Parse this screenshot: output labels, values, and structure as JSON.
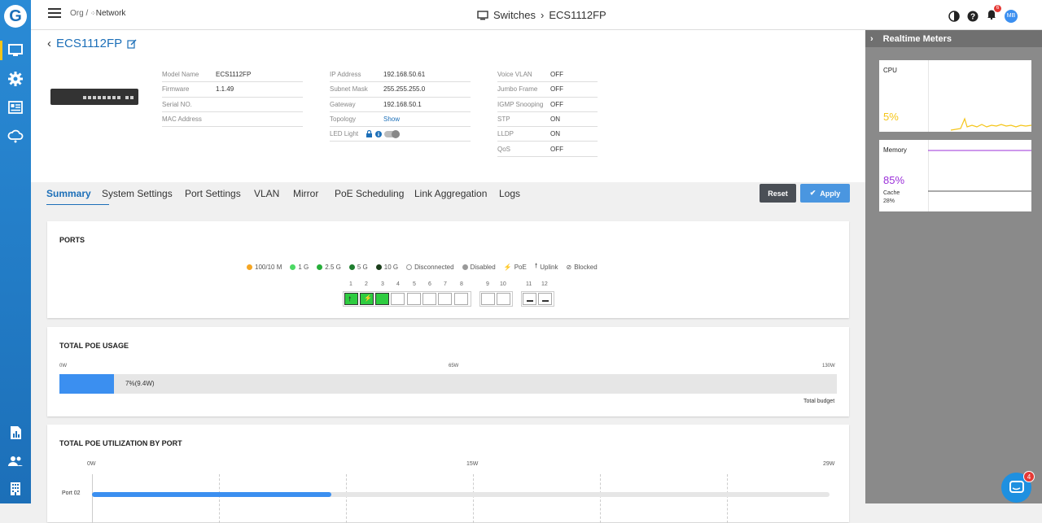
{
  "topbar": {
    "org": "Org /",
    "network": "Network",
    "title": "Switches",
    "subtitle": "ECS1112FP",
    "notif_count": "6",
    "avatar": "MB"
  },
  "device": {
    "name": "ECS1112FP",
    "col1": [
      {
        "k": "Model Name",
        "v": "ECS1112FP"
      },
      {
        "k": "Firmware",
        "v": "1.1.49"
      },
      {
        "k": "Serial NO.",
        "v": ""
      },
      {
        "k": "MAC Address",
        "v": ""
      }
    ],
    "col2": [
      {
        "k": "IP Address",
        "v": "192.168.50.61"
      },
      {
        "k": "Subnet Mask",
        "v": "255.255.255.0"
      },
      {
        "k": "Gateway",
        "v": "192.168.50.1"
      },
      {
        "k": "Topology",
        "v": "Show"
      },
      {
        "k": "LED Light",
        "v": ""
      }
    ],
    "col3": [
      {
        "k": "Voice VLAN",
        "v": "OFF"
      },
      {
        "k": "Jumbo Frame",
        "v": "OFF"
      },
      {
        "k": "IGMP Snooping",
        "v": "OFF"
      },
      {
        "k": "STP",
        "v": "ON"
      },
      {
        "k": "LLDP",
        "v": "ON"
      },
      {
        "k": "QoS",
        "v": "OFF"
      }
    ]
  },
  "tabs": [
    "Summary",
    "System Settings",
    "Port Settings",
    "VLAN",
    "Mirror",
    "PoE Scheduling",
    "Link Aggregation",
    "Logs"
  ],
  "buttons": {
    "reset": "Reset",
    "apply": "Apply"
  },
  "ports_card": {
    "title": "PORTS",
    "legend": [
      {
        "label": "100/10 M",
        "color": "#f5a623"
      },
      {
        "label": "1 G",
        "color": "#4cd964"
      },
      {
        "label": "2.5 G",
        "color": "#27ae3a"
      },
      {
        "label": "5 G",
        "color": "#1e7d2e"
      },
      {
        "label": "10 G",
        "color": "#1a3d1a"
      },
      {
        "label": "Disconnected",
        "color": "#ffffff"
      },
      {
        "label": "Disabled",
        "color": "#999999"
      },
      {
        "label": "PoE",
        "color": ""
      },
      {
        "label": "Uplink",
        "color": ""
      },
      {
        "label": "Blocked",
        "color": ""
      }
    ],
    "port_numbers": [
      "1",
      "2",
      "3",
      "4",
      "5",
      "6",
      "7",
      "8",
      "9",
      "10",
      "11",
      "12"
    ]
  },
  "poe_usage": {
    "title": "TOTAL POE USAGE",
    "min": "0W",
    "mid": "65W",
    "max": "130W",
    "value_label": "7%(9.4W)",
    "percent": 7,
    "footer": "Total budget"
  },
  "poe_port": {
    "title": "TOTAL POE UTILIZATION BY PORT",
    "min": "0W",
    "mid": "15W",
    "max": "29W",
    "port_label": "Port 02",
    "value_w": 9.4
  },
  "right_panel": {
    "title": "Realtime Meters",
    "cpu_label": "CPU",
    "cpu_value": "5%",
    "mem_label": "Memory",
    "mem_value": "85%",
    "cache_label": "Cache",
    "cache_value": "28%"
  },
  "chat_badge": "4",
  "colors": {
    "accent": "#1c6fb8",
    "bar": "#3b8ff0",
    "cpu": "#f5c518",
    "mem": "#9b30d9"
  }
}
